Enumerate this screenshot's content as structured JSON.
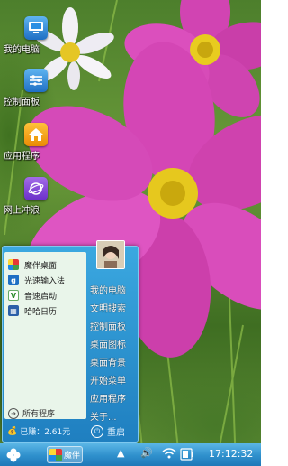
{
  "desktop": {
    "icons": [
      {
        "label": "我的电脑",
        "icon": "computer-icon"
      },
      {
        "label": "控制面板",
        "icon": "control-panel-icon"
      },
      {
        "label": "应用程序",
        "icon": "applications-icon"
      },
      {
        "label": "网上冲浪",
        "icon": "browser-icon"
      }
    ]
  },
  "start_menu": {
    "apps": [
      {
        "label": "魔伴桌面",
        "icon": "pinwheel-icon"
      },
      {
        "label": "光速输入法",
        "icon": "input-method-icon"
      },
      {
        "label": "音速启动",
        "icon": "launcher-icon"
      },
      {
        "label": "哈哈日历",
        "icon": "calendar-icon"
      }
    ],
    "all_programs": "所有程序",
    "right_items": [
      "我的电脑",
      "文明搜索",
      "控制面板",
      "桌面图标",
      "桌面背景",
      "开始菜单",
      "应用程序",
      "关于..."
    ],
    "storage_text": "已赚：2.61元",
    "restart_label": "重启"
  },
  "taskbar": {
    "running_app_label": "魔伴",
    "clock": "17:12:32"
  },
  "colors": {
    "menu_blue": "#2a93d2",
    "taskbar_blue": "#3a9ad6",
    "flower_pink": "#d946b8",
    "flower_center": "#f2d21c"
  }
}
